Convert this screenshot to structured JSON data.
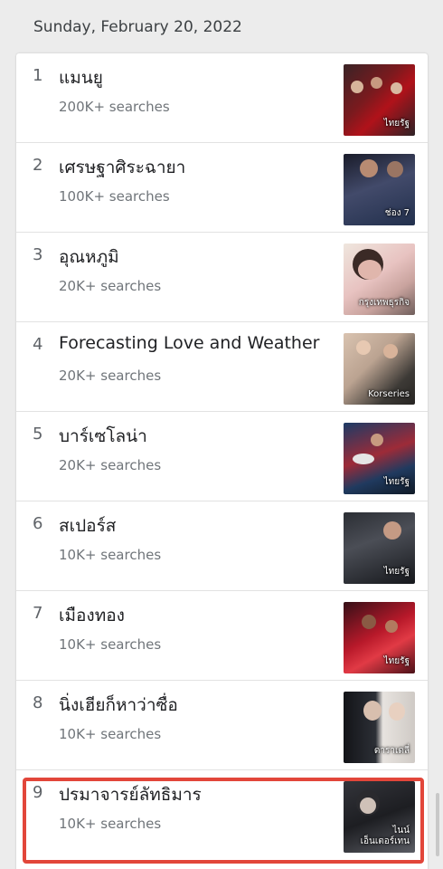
{
  "header": {
    "date": "Sunday, February 20, 2022"
  },
  "trends": [
    {
      "rank": "1",
      "title": "แมนยู",
      "searches": "200K+ searches",
      "source": "ไทยรัฐ"
    },
    {
      "rank": "2",
      "title": "เศรษฐาศิระฉายา",
      "searches": "100K+ searches",
      "source": "ช่อง 7"
    },
    {
      "rank": "3",
      "title": "อุณหภูมิ",
      "searches": "20K+ searches",
      "source": "กรุงเทพธุรกิจ"
    },
    {
      "rank": "4",
      "title": "Forecasting Love and Weather",
      "searches": "20K+ searches",
      "source": "Korseries"
    },
    {
      "rank": "5",
      "title": "บาร์เซโลน่า",
      "searches": "20K+ searches",
      "source": "ไทยรัฐ"
    },
    {
      "rank": "6",
      "title": "สเปอร์ส",
      "searches": "10K+ searches",
      "source": "ไทยรัฐ"
    },
    {
      "rank": "7",
      "title": "เมืองทอง",
      "searches": "10K+ searches",
      "source": "ไทยรัฐ"
    },
    {
      "rank": "8",
      "title": "นิ่งเฮียก็หาว่าซื่อ",
      "searches": "10K+ searches",
      "source": "ดาราเดลี่"
    },
    {
      "rank": "9",
      "title": "ปรมาจารย์ลัทธิมาร",
      "searches": "10K+ searches",
      "source": "ไนน์ เอ็นเตอร์เทน"
    }
  ],
  "colors": {
    "highlight_border": "#e2463a",
    "card_background": "#ffffff",
    "page_background": "#ececec"
  }
}
